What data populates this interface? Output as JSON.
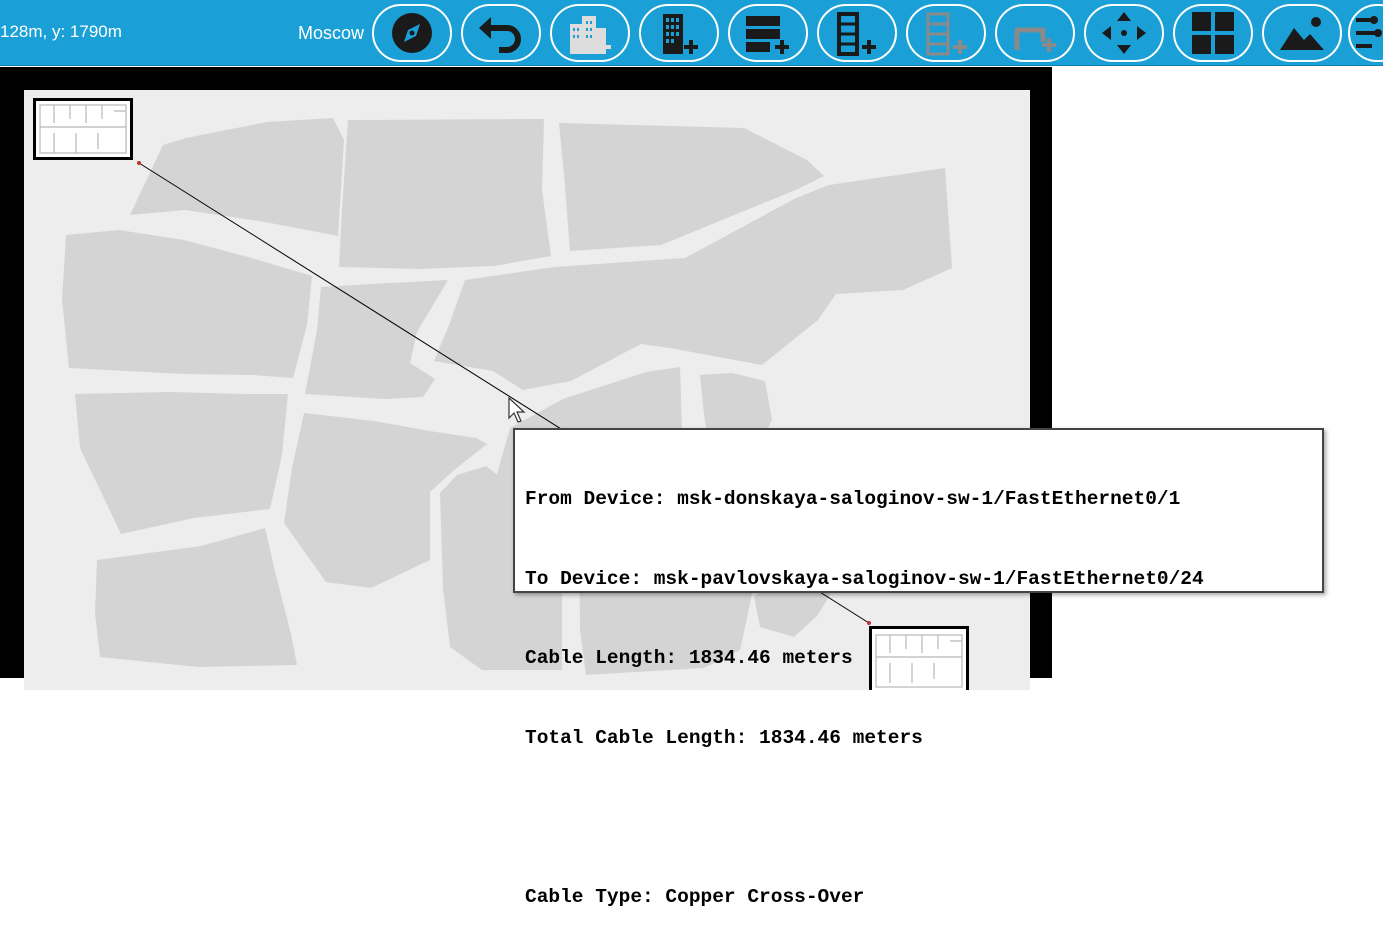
{
  "toolbar": {
    "coords": "128m, y: 1790m",
    "city": "Moscow",
    "buttons": [
      {
        "name": "navigation-compass-icon"
      },
      {
        "name": "back-arrow-icon"
      },
      {
        "name": "new-city-icon"
      },
      {
        "name": "new-building-icon"
      },
      {
        "name": "new-rack-icon"
      },
      {
        "name": "new-shelf-icon"
      },
      {
        "name": "new-closet-icon"
      },
      {
        "name": "new-table-icon"
      },
      {
        "name": "move-icon"
      },
      {
        "name": "grid-icon"
      },
      {
        "name": "background-image-icon"
      },
      {
        "name": "cable-tools-icon"
      }
    ],
    "accent": "#1aa0d6"
  },
  "map": {
    "background": "#ededed",
    "block_color": "#d4d4d4"
  },
  "cable_tooltip": {
    "from_device": "From Device: msk-donskaya-saloginov-sw-1/FastEthernet0/1",
    "to_device": "To Device: msk-pavlovskaya-saloginov-sw-1/FastEthernet0/24",
    "cable_length": "Cable Length: 1834.46 meters",
    "total_cable_length": "Total Cable Length: 1834.46 meters",
    "cable_type": "Cable Type: Copper Cross-Over"
  }
}
